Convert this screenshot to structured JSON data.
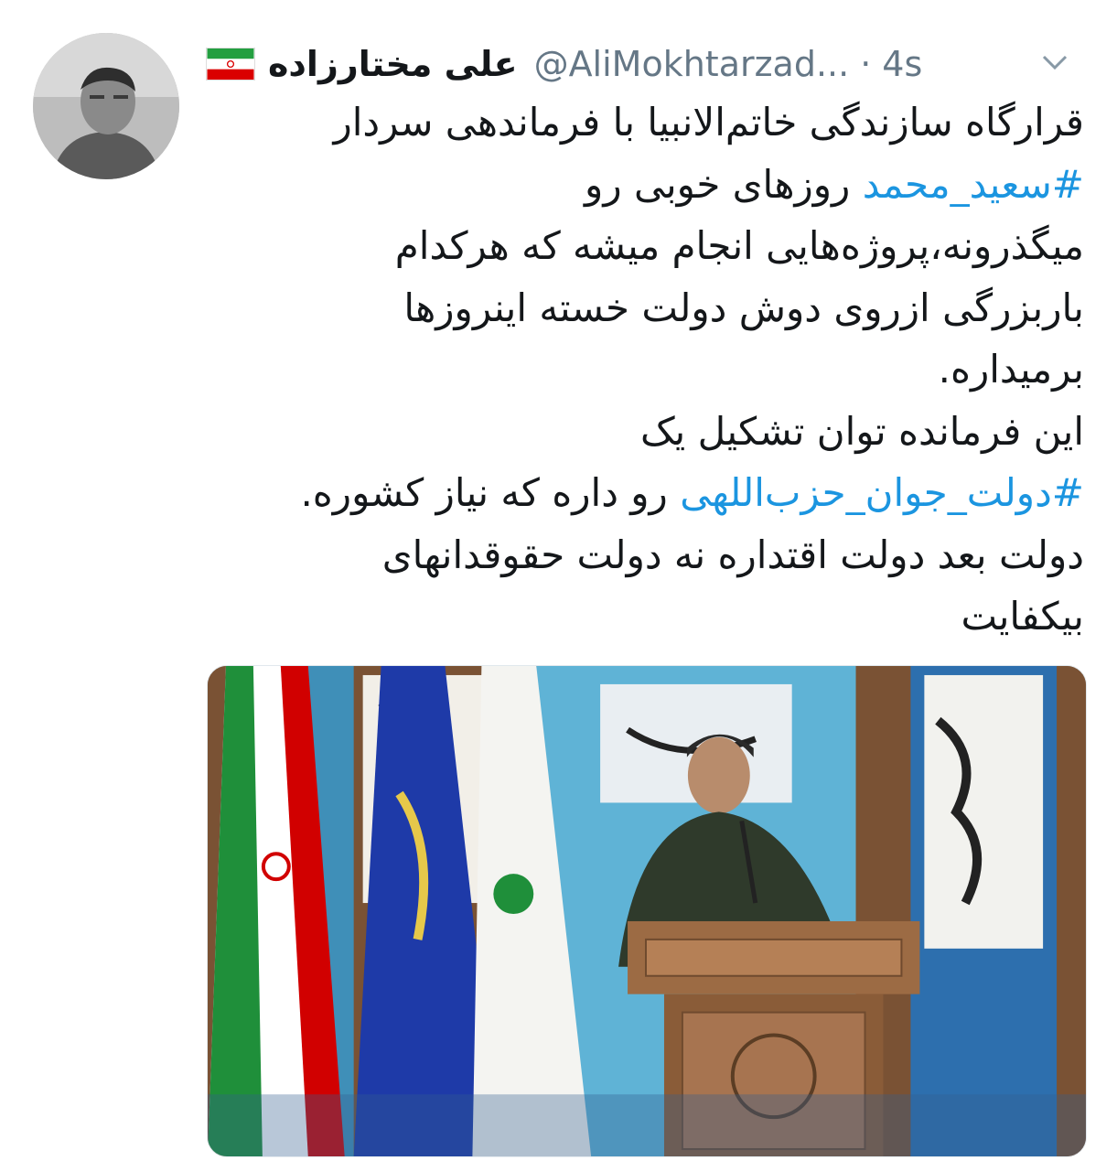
{
  "tweet": {
    "display_name": "علی مختارزاده",
    "handle": "@AliMokhtarzad...",
    "separator": "·",
    "time": "4s",
    "flag_icon": "iran-flag-icon",
    "menu_icon": "chevron-down-icon",
    "text_lines": [
      {
        "text": "قرارگاه سازندگی خاتم‌الانبیا با فرماندهی سردار"
      },
      {
        "hashtag": "#سعید_محمد",
        "text": " روزهای خوبی رو"
      },
      {
        "text": "میگذرونه،پروژه‌هایی انجام میشه که هرکدام"
      },
      {
        "text": "باربزرگی ازروی دوش دولت خسته اینروزها"
      },
      {
        "text": "برمیداره."
      },
      {
        "text": "این فرمانده توان تشکیل یک"
      },
      {
        "hashtag": "#دولت_جوان_حزب‌اللهی",
        "text": " رو داره که نیاز کشوره."
      },
      {
        "text": "دولت بعد دولت اقتداره نه دولت حقوقدانهای"
      },
      {
        "text": "بیکفایت"
      }
    ],
    "media": {
      "description_icon": "photo-speaker-at-podium-icon"
    }
  },
  "colors": {
    "text": "#14171a",
    "muted": "#657786",
    "hashtag": "#1b95e0"
  }
}
